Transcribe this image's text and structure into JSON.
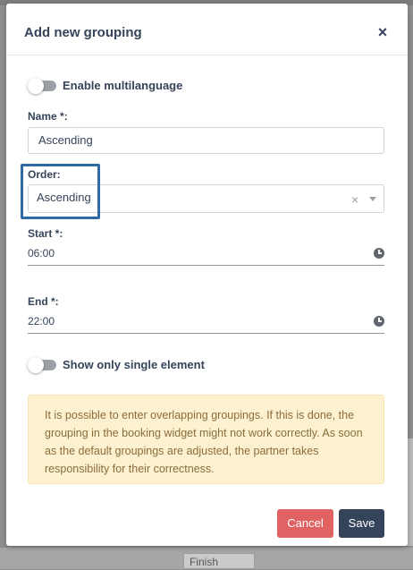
{
  "modal": {
    "title": "Add new grouping",
    "close_glyph": "×"
  },
  "toggles": {
    "multilanguage": {
      "label": "Enable multilanguage",
      "enabled": false
    },
    "single_element": {
      "label": "Show only single element",
      "enabled": false
    }
  },
  "fields": {
    "name": {
      "label": "Name *:",
      "value": "Ascending"
    },
    "order": {
      "label": "Order:",
      "value": "Ascending",
      "clear_glyph": "×"
    },
    "start": {
      "label": "Start *:",
      "value": "06:00"
    },
    "end": {
      "label": "End *:",
      "value": "22:00"
    }
  },
  "warning": {
    "text": "It is possible to enter overlapping groupings. If this is done, the grouping in the booking widget might not work correctly. As soon as the default groupings are adjusted, the partner takes responsibility for their correctness."
  },
  "buttons": {
    "cancel": "Cancel",
    "save": "Save"
  },
  "background": {
    "finish_field": "Finish"
  },
  "colors": {
    "primary": "#35445a",
    "danger": "#e16262",
    "warning_bg": "#fdf1d0",
    "highlight": "#2f6aa6"
  }
}
